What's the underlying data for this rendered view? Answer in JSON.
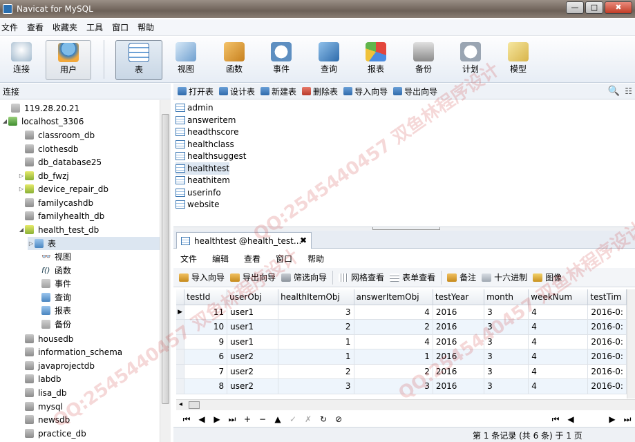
{
  "window": {
    "title": "Navicat for MySQL",
    "controls": [
      "—",
      "□",
      "✖"
    ]
  },
  "menu": [
    "文件",
    "查看",
    "收藏夹",
    "工具",
    "窗口",
    "帮助"
  ],
  "toolbar": {
    "connect": "连接",
    "user": "用户",
    "table": "表",
    "view": "视图",
    "function": "函数",
    "event": "事件",
    "query": "查询",
    "report": "报表",
    "backup": "备份",
    "schedule": "计划",
    "model": "模型"
  },
  "left_header": "连接",
  "tree": {
    "server": "119.28.20.21",
    "local": "localhost_3306",
    "dbs_top": [
      "classroom_db",
      "clothesdb",
      "db_database25",
      "db_fwzj",
      "device_repair_db",
      "familycashdb",
      "familyhealth_db",
      "health_test_db"
    ],
    "children": [
      "表",
      "视图",
      "函数",
      "事件",
      "查询",
      "报表",
      "备份"
    ],
    "dbs_bottom": [
      "housedb",
      "information_schema",
      "javaprojectdb",
      "labdb",
      "lisa_db",
      "mysql",
      "newsdb",
      "practice_db"
    ]
  },
  "object_toolbar": [
    "打开表",
    "设计表",
    "新建表",
    "删除表",
    "导入向导",
    "导出向导"
  ],
  "tables": [
    "admin",
    "answeritem",
    "headthscore",
    "healthclass",
    "healthsuggest",
    "healthtest",
    "heathitem",
    "userinfo",
    "website"
  ],
  "tab": {
    "label": "healthtest @health_test...",
    "close": "✖"
  },
  "sub_menu": [
    "文件",
    "编辑",
    "查看",
    "窗口",
    "帮助"
  ],
  "sub_toolbar": [
    "导入向导",
    "导出向导",
    "筛选向导",
    "网格查看",
    "表单查看",
    "备注",
    "十六进制",
    "图像"
  ],
  "grid": {
    "columns": [
      "testId",
      "userObj",
      "healthItemObj",
      "answerItemObj",
      "testYear",
      "month",
      "weekNum",
      "testTim"
    ],
    "rows": [
      [
        "11",
        "user1",
        "3",
        "4",
        "2016",
        "3",
        "4",
        "2016-0:"
      ],
      [
        "10",
        "user1",
        "2",
        "2",
        "2016",
        "3",
        "4",
        "2016-0:"
      ],
      [
        "9",
        "user1",
        "1",
        "4",
        "2016",
        "3",
        "4",
        "2016-0:"
      ],
      [
        "6",
        "user2",
        "1",
        "1",
        "2016",
        "3",
        "4",
        "2016-0:"
      ],
      [
        "7",
        "user2",
        "2",
        "2",
        "2016",
        "3",
        "4",
        "2016-0:"
      ],
      [
        "8",
        "user2",
        "3",
        "3",
        "2016",
        "3",
        "4",
        "2016-0:"
      ]
    ]
  },
  "nav_buttons": [
    "⏮",
    "◀",
    "▶",
    "⏭",
    "+",
    "−",
    "▲",
    "✓",
    "✗",
    "↻",
    "⊘"
  ],
  "status": "第 1 条记录 (共 6 条) 于 1 页",
  "watermark": "QQ:2545440457 双鱼林程序设计"
}
